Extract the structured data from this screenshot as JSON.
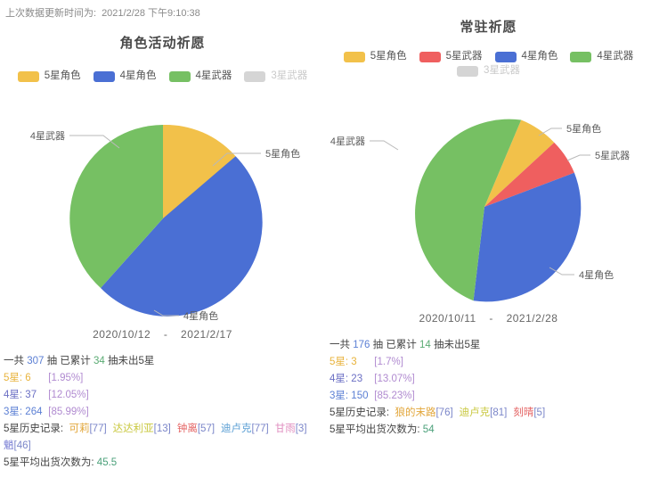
{
  "update": {
    "label": "上次数据更新时间为:",
    "value": "2021/2/28 下午9:10:38"
  },
  "colors": {
    "star5_char": "#f2c14a",
    "star5_weapon": "#ef5f5f",
    "star4_char": "#4a6fd4",
    "star4_weapon": "#76c063",
    "star3_weapon": "#cccccc"
  },
  "panels": [
    {
      "title": "角色活动祈愿",
      "legend": [
        {
          "label": "5星角色",
          "color": "#f2c14a",
          "dim": false
        },
        {
          "label": "4星角色",
          "color": "#4a6fd4",
          "dim": false
        },
        {
          "label": "4星武器",
          "color": "#76c063",
          "dim": false
        },
        {
          "label": "3星武器",
          "color": "#d5d5d5",
          "dim": true
        }
      ],
      "date_start": "2020/10/12",
      "date_sep": "-",
      "date_end": "2021/2/17",
      "total_prefix": "一共",
      "total_count": "307",
      "total_mid": "抽  已累计",
      "pity_count": "34",
      "total_suffix": "抽未出5星",
      "rows": [
        {
          "label": "5星:",
          "count": "6",
          "pct": "[1.95%]"
        },
        {
          "label": "4星:",
          "count": "37",
          "pct": "[12.05%]"
        },
        {
          "label": "3星:",
          "count": "264",
          "pct": "[85.99%]"
        }
      ],
      "history_label": "5星历史记录:",
      "history": [
        {
          "name": "可莉",
          "pulls": "[77]"
        },
        {
          "name": "达达利亚",
          "pulls": "[13]"
        },
        {
          "name": "钟离",
          "pulls": "[57]"
        },
        {
          "name": "迪卢克",
          "pulls": "[77]"
        },
        {
          "name": "甘雨",
          "pulls": "[3]"
        },
        {
          "name": "魈",
          "pulls": "[46]"
        }
      ],
      "avg_label": "5星平均出货次数为:",
      "avg_value": "45.5"
    },
    {
      "title": "常驻祈愿",
      "legend": [
        {
          "label": "5星角色",
          "color": "#f2c14a",
          "dim": false
        },
        {
          "label": "5星武器",
          "color": "#ef5f5f",
          "dim": false
        },
        {
          "label": "4星角色",
          "color": "#4a6fd4",
          "dim": false
        },
        {
          "label": "4星武器",
          "color": "#76c063",
          "dim": false
        },
        {
          "label": "3星武器",
          "color": "#d5d5d5",
          "dim": true
        }
      ],
      "date_start": "2020/10/11",
      "date_sep": "-",
      "date_end": "2021/2/28",
      "total_prefix": "一共",
      "total_count": "176",
      "total_mid": "抽  已累计",
      "pity_count": "14",
      "total_suffix": "抽未出5星",
      "rows": [
        {
          "label": "5星:",
          "count": "3",
          "pct": "[1.7%]"
        },
        {
          "label": "4星:",
          "count": "23",
          "pct": "[13.07%]"
        },
        {
          "label": "3星:",
          "count": "150",
          "pct": "[85.23%]"
        }
      ],
      "history_label": "5星历史记录:",
      "history": [
        {
          "name": "狼的末路",
          "pulls": "[76]"
        },
        {
          "name": "迪卢克",
          "pulls": "[81]"
        },
        {
          "name": "刻晴",
          "pulls": "[5]"
        }
      ],
      "avg_label": "5星平均出货次数为:",
      "avg_value": "54"
    }
  ],
  "chart_data": [
    {
      "type": "pie",
      "title": "角色活动祈愿",
      "labels": [
        "5星角色",
        "4星角色",
        "4星武器"
      ],
      "values": [
        6,
        37,
        264
      ],
      "display_slices": [
        {
          "label": "5星角色",
          "color": "#f2c14a",
          "fraction": 0.13
        },
        {
          "label": "4星角色",
          "color": "#4a6fd4",
          "fraction": 0.565
        },
        {
          "label": "4星武器",
          "color": "#76c063",
          "fraction": 0.305
        }
      ],
      "legend_position": "top",
      "hidden_series": [
        "3星武器"
      ]
    },
    {
      "type": "pie",
      "title": "常驻祈愿",
      "labels": [
        "5星角色",
        "5星武器",
        "4星角色",
        "4星武器"
      ],
      "values": [
        3,
        3,
        23,
        150
      ],
      "display_slices": [
        {
          "label": "5星角色",
          "color": "#f2c14a",
          "fraction": 0.095
        },
        {
          "label": "5星武器",
          "color": "#ef5f5f",
          "fraction": 0.055
        },
        {
          "label": "4星角色",
          "color": "#4a6fd4",
          "fraction": 0.345
        },
        {
          "label": "4星武器",
          "color": "#76c063",
          "fraction": 0.505
        }
      ],
      "legend_position": "top",
      "hidden_series": [
        "3星武器"
      ]
    }
  ]
}
